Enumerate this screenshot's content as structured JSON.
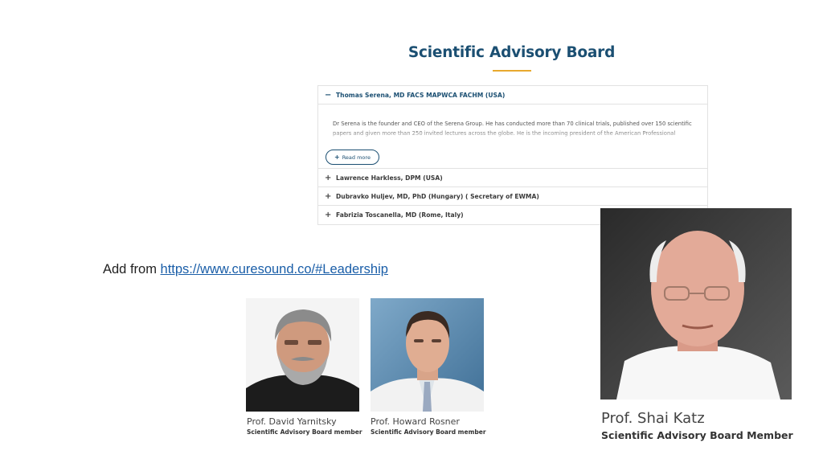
{
  "section": {
    "title": "Scientific Advisory Board",
    "accent_color": "#e8a92e"
  },
  "accordion": {
    "items": [
      {
        "label": "Thomas Serena, MD FACS MAPWCA FACHM (USA)",
        "expanded": true,
        "body": "Dr Serena is the founder and CEO of the Serena Group. He has conducted more than 70 clinical trials, published over 150 scientific papers and given more than 250 invited lectures across the globe. He is the incoming president of the American Professional Wound",
        "read_more_label": "Read more"
      },
      {
        "label": "Lawrence Harkless, DPM (USA)",
        "expanded": false
      },
      {
        "label": "Dubravko Huljev, MD, PhD (Hungary) ( Secretary of EWMA)",
        "expanded": false
      },
      {
        "label": "Fabrizia Toscanella, MD (Rome, Italy)",
        "expanded": false
      }
    ]
  },
  "note": {
    "prefix": "Add from ",
    "link_text": "https://www.curesound.co/#Leadership"
  },
  "members": [
    {
      "name": "Prof. David Yarnitsky",
      "role": "Scientific Advisory Board member"
    },
    {
      "name": "Prof. Howard Rosner",
      "role": "Scientific Advisory Board member"
    },
    {
      "name": "Prof. Shai Katz",
      "role": "Scientific Advisory Board Member"
    }
  ],
  "icons": {
    "expanded": "minus-icon",
    "collapsed": "plus-icon",
    "read_more": "plus-icon"
  }
}
